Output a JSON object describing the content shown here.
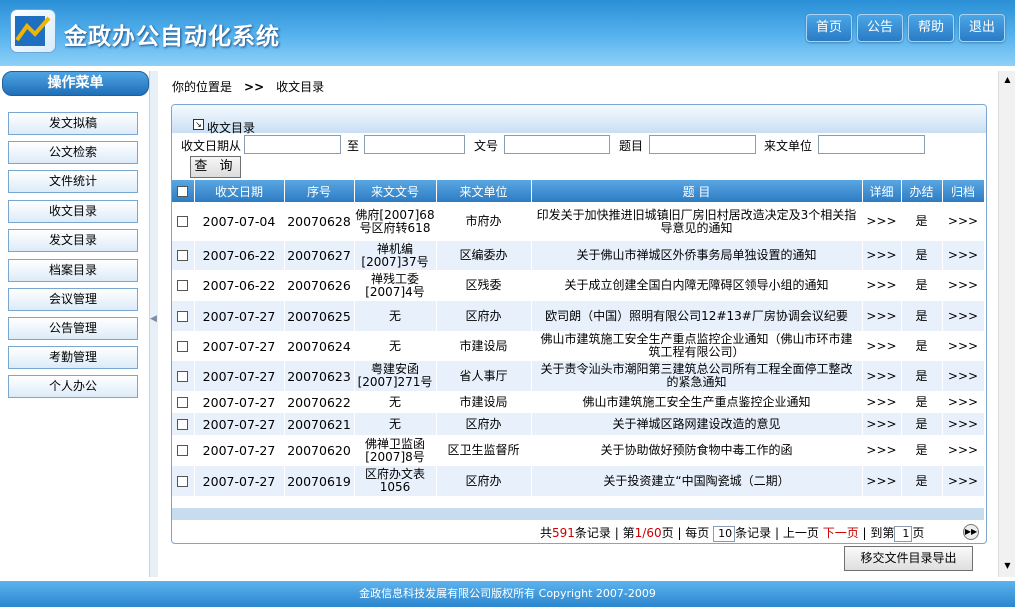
{
  "header": {
    "title": "金政办公自动化系统",
    "buttons": [
      "首页",
      "公告",
      "帮助",
      "退出"
    ]
  },
  "menu": {
    "title": "操作菜单",
    "items": [
      "发文拟稿",
      "公文检索",
      "文件统计",
      "收文目录",
      "发文目录",
      "档案目录",
      "会议管理",
      "公告管理",
      "考勤管理",
      "个人办公"
    ]
  },
  "breadcrumb": {
    "label": "你的位置是",
    "sep": ">>",
    "current": "收文目录"
  },
  "panel": {
    "title": "收文目录"
  },
  "search": {
    "date_from_label": "收文日期从",
    "date_to_label": "至",
    "doc_no_label": "文号",
    "subject_label": "题目",
    "unit_label": "来文单位",
    "date_from": "",
    "date_to": "",
    "doc_no": "",
    "subject": "",
    "unit": "",
    "query_label": "查 询"
  },
  "table": {
    "columns": [
      "收文日期",
      "序号",
      "来文文号",
      "来文单位",
      "题 目",
      "详细",
      "办结",
      "归档"
    ],
    "rows": [
      {
        "date": "2007-07-04",
        "seq": "20070628",
        "docno": "佛府[2007]68号区府转618",
        "unit": "市府办",
        "title": "印发关于加快推进旧城镇旧厂房旧村居改造决定及3个相关指导意见的通知",
        "detail": ">>>",
        "done": "是",
        "archive": ">>>"
      },
      {
        "date": "2007-06-22",
        "seq": "20070627",
        "docno": "禅机编[2007]37号",
        "unit": "区编委办",
        "title": "关于佛山市禅城区外侨事务局单独设置的通知",
        "detail": ">>>",
        "done": "是",
        "archive": ">>>"
      },
      {
        "date": "2007-06-22",
        "seq": "20070626",
        "docno": "禅残工委[2007]4号",
        "unit": "区残委",
        "title": "关于成立创建全国白内障无障碍区领导小组的通知",
        "detail": ">>>",
        "done": "是",
        "archive": ">>>"
      },
      {
        "date": "2007-07-27",
        "seq": "20070625",
        "docno": "无",
        "unit": "区府办",
        "title": "欧司朗（中国）照明有限公司12#13#厂房协调会议纪要",
        "detail": ">>>",
        "done": "是",
        "archive": ">>>"
      },
      {
        "date": "2007-07-27",
        "seq": "20070624",
        "docno": "无",
        "unit": "市建设局",
        "title": "佛山市建筑施工安全生产重点监控企业通知（佛山市环市建筑工程有限公司）",
        "detail": ">>>",
        "done": "是",
        "archive": ">>>"
      },
      {
        "date": "2007-07-27",
        "seq": "20070623",
        "docno": "粤建安函[2007]271号",
        "unit": "省人事厅",
        "title": "关于责令汕头市潮阳第三建筑总公司所有工程全面停工整改的紧急通知",
        "detail": ">>>",
        "done": "是",
        "archive": ">>>"
      },
      {
        "date": "2007-07-27",
        "seq": "20070622",
        "docno": "无",
        "unit": "市建设局",
        "title": "佛山市建筑施工安全生产重点鉴控企业通知",
        "detail": ">>>",
        "done": "是",
        "archive": ">>>"
      },
      {
        "date": "2007-07-27",
        "seq": "20070621",
        "docno": "无",
        "unit": "区府办",
        "title": "关于禅城区路网建设改造的意见",
        "detail": ">>>",
        "done": "是",
        "archive": ">>>"
      },
      {
        "date": "2007-07-27",
        "seq": "20070620",
        "docno": "佛禅卫监函[2007]8号",
        "unit": "区卫生监督所",
        "title": "关于协助做好预防食物中毒工作的函",
        "detail": ">>>",
        "done": "是",
        "archive": ">>>"
      },
      {
        "date": "2007-07-27",
        "seq": "20070619",
        "docno": "区府办文表1056",
        "unit": "区府办",
        "title": "关于投资建立“中国陶瓷城（二期）",
        "detail": ">>>",
        "done": "是",
        "archive": ">>>"
      }
    ]
  },
  "pager": {
    "total_prefix": "共",
    "total": "591",
    "total_suffix": "条记录",
    "page_prefix": "第",
    "page": "1/60",
    "page_suffix": "页",
    "per_page_prefix": "每页",
    "per_page": "10",
    "per_page_suffix": "条记录",
    "prev": "上一页",
    "next": "下一页",
    "goto_prefix": "到第",
    "goto_value": "1",
    "goto_suffix": "页"
  },
  "export_label": "移交文件目录导出",
  "footer": {
    "text": "金政信息科技发展有限公司版权所有   Copyright 2007-2009"
  },
  "colors": {
    "header_blue": "#2a8fd6",
    "grid_header": "#2d7cc3",
    "row_alt": "#e8f1fb",
    "pager_red": "#cc0000"
  }
}
